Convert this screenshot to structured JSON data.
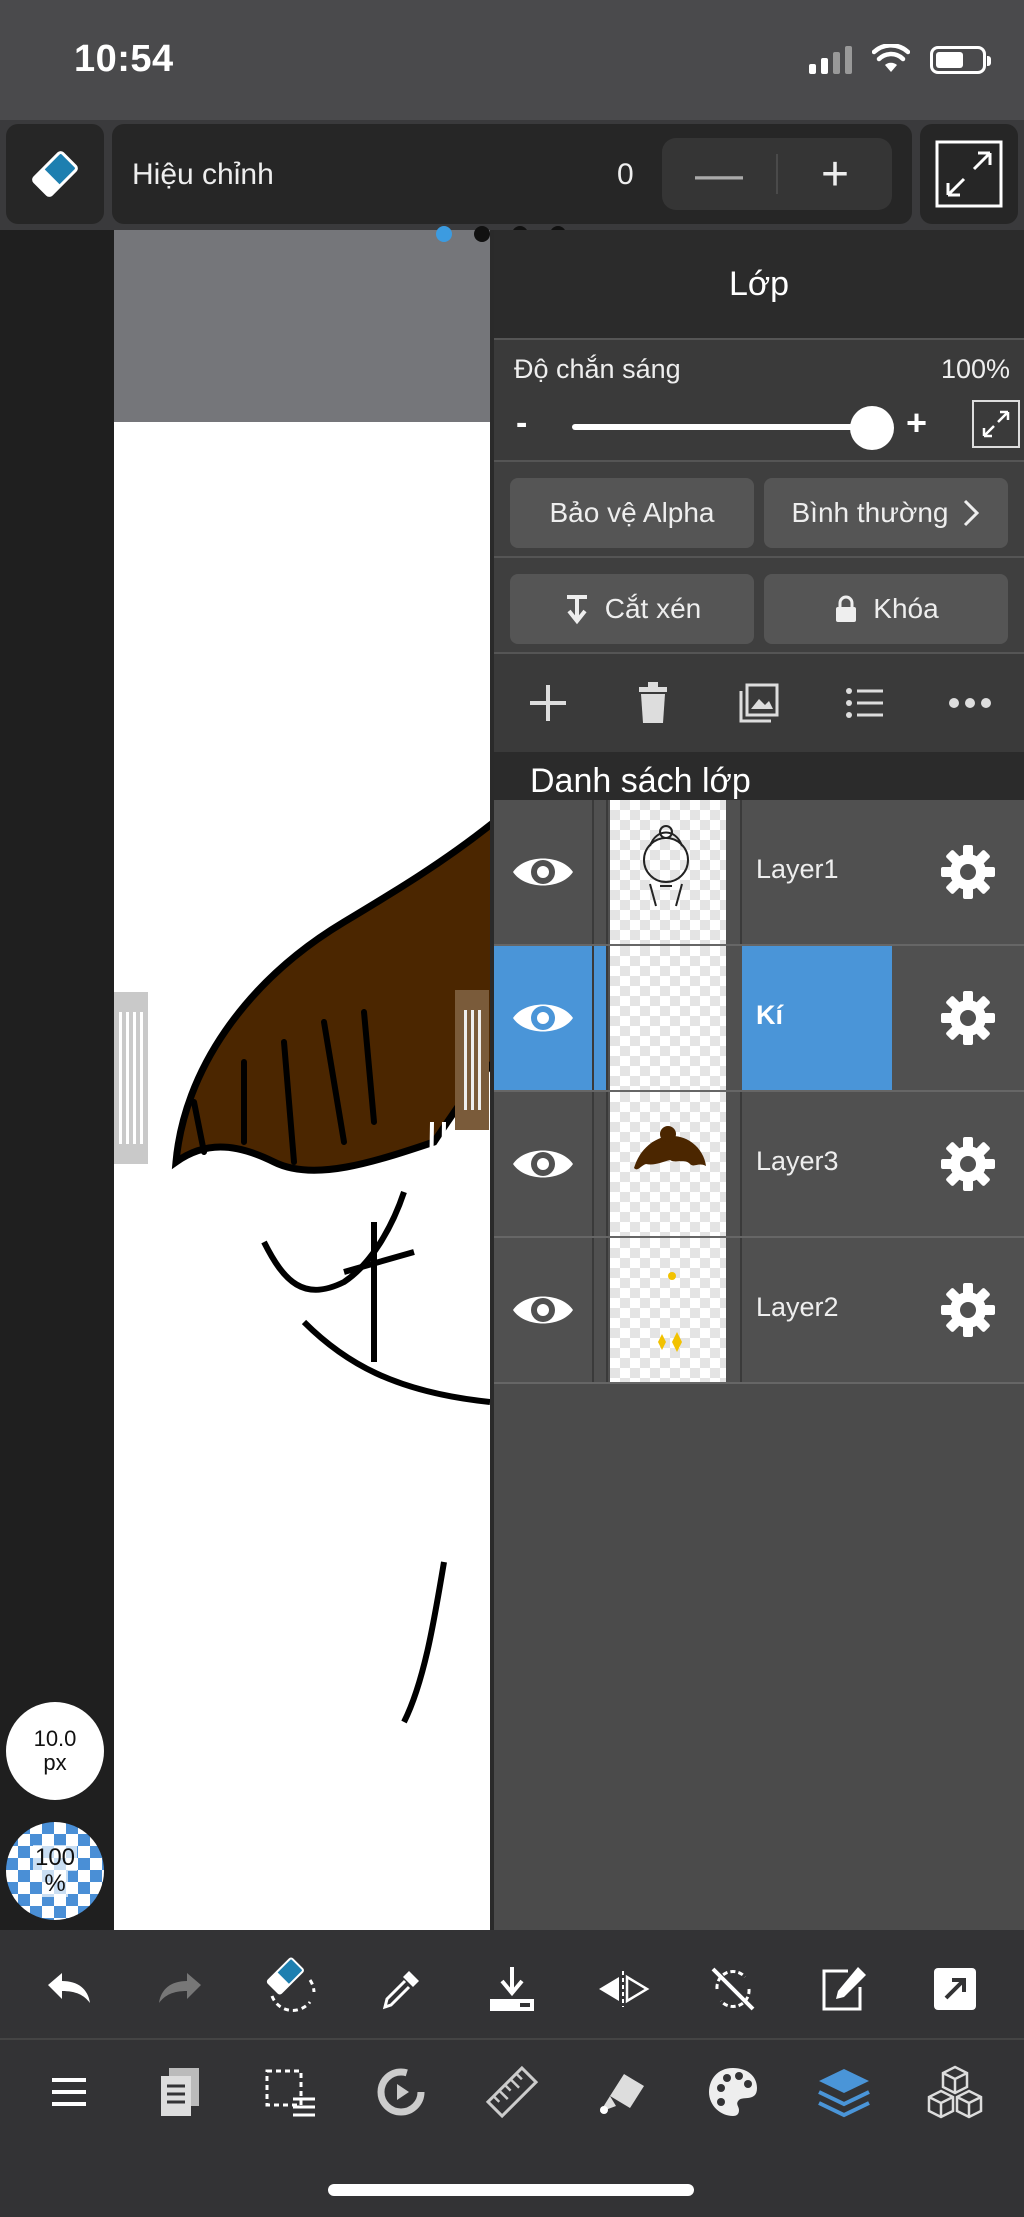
{
  "status_bar": {
    "time": "10:54"
  },
  "top_toolbar": {
    "adjust_label": "Hiệu chỉnh",
    "adjust_value": "0",
    "minus_label": "—",
    "plus_label": "+"
  },
  "canvas": {
    "brush_size_value": "10.0",
    "brush_size_unit": "px",
    "opacity_value": "100",
    "opacity_unit": "%"
  },
  "layer_panel": {
    "title": "Lớp",
    "opacity_label": "Độ chắn sáng",
    "opacity_value": "100%",
    "opacity_level": 1.0,
    "slider_minus": "-",
    "slider_plus": "+",
    "alpha_protect_label": "Bảo vệ Alpha",
    "blend_mode_label": "Bình thường",
    "clip_label": "Cắt xén",
    "lock_label": "Khóa",
    "list_title": "Danh sách lớp",
    "layers": [
      {
        "name": "Layer1",
        "selected": false
      },
      {
        "name": "Kí",
        "selected": true
      },
      {
        "name": "Layer3",
        "selected": false
      },
      {
        "name": "Layer2",
        "selected": false
      }
    ]
  },
  "colors": {
    "accent": "#4a95d8",
    "panel_bg": "#4b4b4b",
    "toolbar_bg": "#333335"
  }
}
